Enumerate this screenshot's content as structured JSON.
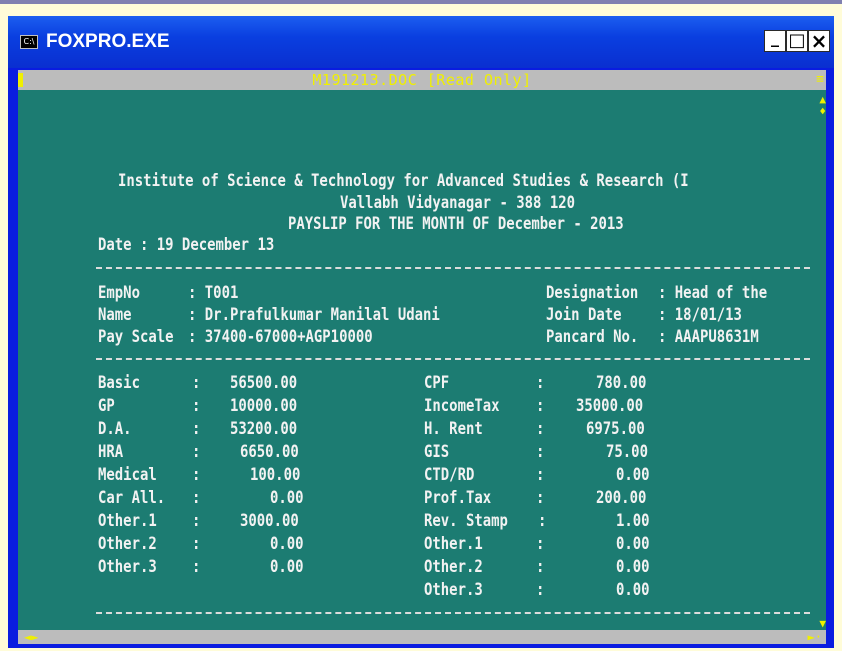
{
  "window": {
    "title": "FOXPRO.EXE",
    "icon_text": "C:\\",
    "minimize_label": "_",
    "maximize_label": "□",
    "close_label": "×"
  },
  "document": {
    "title": "M191213.DOC [Read Only]"
  },
  "payslip": {
    "institute": "Institute of Science & Technology for Advanced Studies & Research (I",
    "city": "Vallabh Vidyanagar - 388 120",
    "heading": "PAYSLIP FOR THE MONTH OF December - 2013",
    "date_line": "Date : 19 December 13",
    "employee": {
      "empno_label": "EmpNo",
      "empno_value": ": T001",
      "name_label": "Name",
      "name_value": ": Dr.Prafulkumar Manilal Udani",
      "payscale_label": "Pay Scale",
      "payscale_value": ": 37400-67000+AGP10000",
      "designation_label": "Designation",
      "designation_value": ": Head of the",
      "joindate_label": "Join Date",
      "joindate_value": ": 18/01/13",
      "pancard_label": "Pancard No.",
      "pancard_value": ": AAAPU8631M"
    },
    "earnings": [
      {
        "label": "Basic",
        "value": "56500.00"
      },
      {
        "label": "GP",
        "value": "10000.00"
      },
      {
        "label": "D.A.",
        "value": "53200.00"
      },
      {
        "label": "HRA",
        "value": "6650.00"
      },
      {
        "label": "Medical",
        "value": "100.00"
      },
      {
        "label": "Car All.",
        "value": "0.00"
      },
      {
        "label": "Other.1",
        "value": "3000.00"
      },
      {
        "label": "Other.2",
        "value": "0.00"
      },
      {
        "label": "Other.3",
        "value": "0.00"
      }
    ],
    "deductions": [
      {
        "label": "CPF",
        "value": "780.00"
      },
      {
        "label": "IncomeTax",
        "value": "35000.00"
      },
      {
        "label": "H. Rent",
        "value": "6975.00"
      },
      {
        "label": "GIS",
        "value": "75.00"
      },
      {
        "label": "CTD/RD",
        "value": "0.00"
      },
      {
        "label": "Prof.Tax",
        "value": "200.00"
      },
      {
        "label": "Rev. Stamp",
        "value": "1.00"
      },
      {
        "label": "Other.1",
        "value": "0.00"
      },
      {
        "label": "Other.2",
        "value": "0.00"
      },
      {
        "label": "Other.3",
        "value": "0.00"
      }
    ],
    "colon": ":"
  },
  "colors": {
    "dos_background": "#1c7c72",
    "dos_text": "#f2f2f2",
    "titlebar_blue": "#0a3fe0",
    "accent_yellow": "#f0f000"
  }
}
